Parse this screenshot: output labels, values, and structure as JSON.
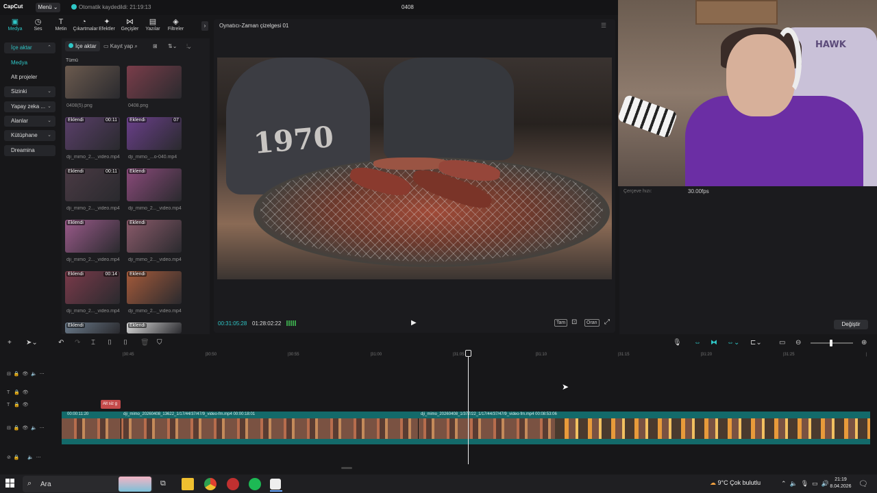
{
  "app": {
    "logo": "CapCut",
    "menu_label": "Menü ⌄",
    "autosave": "Otomatik kaydedildi: 21:19:13",
    "project_title": "0408"
  },
  "toolbar": [
    {
      "label": "Medya",
      "icon": "media-icon",
      "glyph": "▣"
    },
    {
      "label": "Ses",
      "icon": "audio-icon",
      "glyph": "◷"
    },
    {
      "label": "Metin",
      "icon": "text-icon",
      "glyph": "T"
    },
    {
      "label": "Çıkartmalar",
      "icon": "sticker-icon",
      "glyph": "◔"
    },
    {
      "label": "Efektler",
      "icon": "effects-icon",
      "glyph": "✦"
    },
    {
      "label": "Geçişler",
      "icon": "transitions-icon",
      "glyph": "⋈"
    },
    {
      "label": "Yazılar",
      "icon": "captions-icon",
      "glyph": "▤"
    },
    {
      "label": "Filtreler",
      "icon": "filters-icon",
      "glyph": "◈"
    }
  ],
  "sidebar": [
    {
      "label": "İçe aktar",
      "chev": "⌃"
    },
    {
      "label": "Medya",
      "chev": ""
    },
    {
      "label": "Alt projeler",
      "chev": ""
    },
    {
      "label": "Sizinki",
      "chev": "⌄"
    },
    {
      "label": "Yapay zeka ...",
      "chev": "⌄"
    },
    {
      "label": "Alanlar",
      "chev": "⌄"
    },
    {
      "label": "Kütüphane",
      "chev": "⌄"
    },
    {
      "label": "Dreamina",
      "chev": ""
    }
  ],
  "media_actions": {
    "import": "İçe aktar",
    "record": "Kayıt yap",
    "category_all": "Tümü"
  },
  "media_items": [
    {
      "name": "0408(5).png",
      "tag": "",
      "duration": "",
      "color": "#6b5a4e"
    },
    {
      "name": "0408.png",
      "tag": "",
      "duration": "",
      "color": "#7a3d4a"
    },
    {
      "name": "dji_mimo_2..._video.mp4",
      "tag": "Eklendi",
      "duration": "00:11",
      "color": "#5a3f6a"
    },
    {
      "name": "dji_mimo_...o-040.mp4",
      "tag": "Eklendi",
      "duration": "07",
      "color": "#6a3f8a"
    },
    {
      "name": "dji_mimo_2..._video.mp4",
      "tag": "Eklendi",
      "duration": "00:11",
      "color": "#4a3a44"
    },
    {
      "name": "dji_mimo_2..._video.mp4",
      "tag": "Eklendi",
      "duration": "",
      "color": "#8a4a7a"
    },
    {
      "name": "dji_mimo_2..._video.mp4",
      "tag": "Eklendi",
      "duration": "",
      "color": "#9a5a8a"
    },
    {
      "name": "dji_mimo_2..._video.mp4",
      "tag": "Eklendi",
      "duration": "",
      "color": "#8a5a6a"
    },
    {
      "name": "dji_mimo_2..._video.mp4",
      "tag": "Eklendi",
      "duration": "00:14",
      "color": "#7a3a4a"
    },
    {
      "name": "dji_mimo_2..._video.mp4",
      "tag": "Eklendi",
      "duration": "",
      "color": "#a45a3a"
    },
    {
      "name": "",
      "tag": "Eklendi",
      "duration": "",
      "color": "#6a7a8a"
    },
    {
      "name": "",
      "tag": "Eklendi",
      "duration": "",
      "color": "#d8d8d8"
    }
  ],
  "player": {
    "title": "Oynatıcı-Zaman çizelgesi 01",
    "timecode": "00:31:05:28",
    "duration": "01:28:02:22",
    "shirt_text": "1970",
    "controls": [
      "Tam",
      "Oran"
    ]
  },
  "properties": {
    "fps_label": "Çerçeve hızı:",
    "fps_value": "30.00fps",
    "change_button": "Değiştir"
  },
  "webcam": {
    "chair_logo": "HAWK"
  },
  "timeline": {
    "ticks": [
      "|30:45",
      "|30:50",
      "|30:55",
      "|31:00",
      "|31:05",
      "|31:10",
      "|31:15",
      "|31:20",
      "|31:25",
      "|"
    ],
    "text_clip": "Alt siz g",
    "clip_labels": [
      "00:00:11:20",
      "dji_mimo_20260408_13622_1/17/44/37/47/9_video-fm.mp4   00:00:18:01",
      "dji_mimo_20260408_1/377/22_1/17/44/37/47/9_video-fm.mp4   00:08:53:06"
    ]
  },
  "taskbar": {
    "search_placeholder": "Ara",
    "weather": "9°C  Çok bulutlu",
    "time": "21:19",
    "date": "8.04.2026"
  }
}
